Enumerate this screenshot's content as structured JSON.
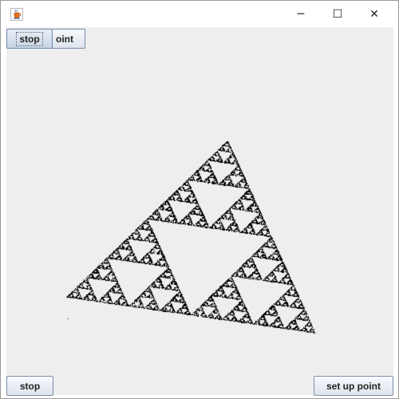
{
  "window": {
    "title": "",
    "icon": "java-cup-icon",
    "controls": {
      "minimize": "─",
      "maximize": "☐",
      "close": "✕"
    }
  },
  "toolbar_top": {
    "setup_label": "set up point",
    "setup_visible_text": "oint",
    "stop_label": "stop"
  },
  "toolbar_bottom": {
    "stop_label": "stop",
    "setup_label": "set up point"
  },
  "canvas": {
    "content": "sierpinski-triangle-point-cloud",
    "background": "#eeeeee",
    "point_color": "#000000"
  }
}
